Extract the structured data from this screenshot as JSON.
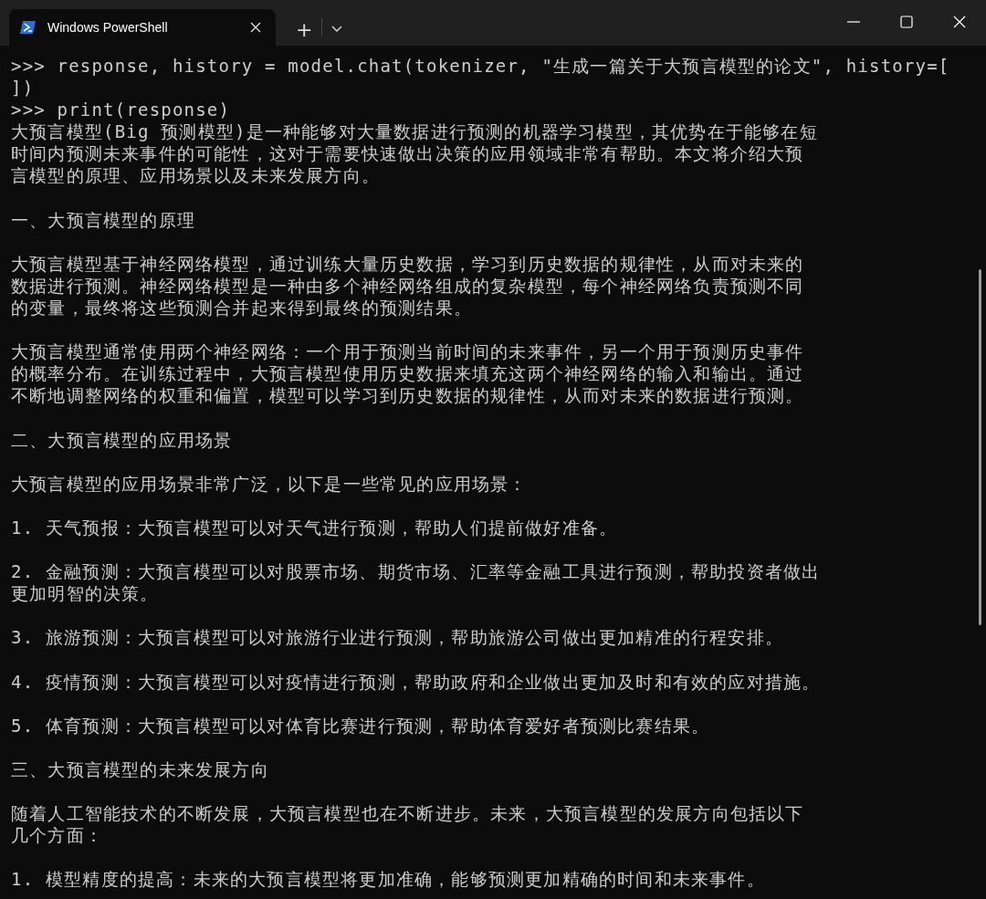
{
  "window": {
    "tab_title": "Windows PowerShell",
    "new_tab": "+"
  },
  "console": {
    "blocks": [
      {
        "rows": [
          ">>> response, history = model.chat(tokenizer, \"生成一篇关于大预言模型的论文\", history=[",
          "])",
          ">>> print(response)",
          "大预言模型(Big 预测模型)是一种能够对大量数据进行预测的机器学习模型，其优势在于能够在短",
          "时间内预测未来事件的可能性，这对于需要快速做出决策的应用领域非常有帮助。本文将介绍大预",
          "言模型的原理、应用场景以及未来发展方向。"
        ]
      },
      {
        "rows": [
          "一、大预言模型的原理"
        ]
      },
      {
        "rows": [
          "大预言模型基于神经网络模型，通过训练大量历史数据，学习到历史数据的规律性，从而对未来的",
          "数据进行预测。神经网络模型是一种由多个神经网络组成的复杂模型，每个神经网络负责预测不同",
          "的变量，最终将这些预测合并起来得到最终的预测结果。"
        ]
      },
      {
        "rows": [
          "大预言模型通常使用两个神经网络：一个用于预测当前时间的未来事件，另一个用于预测历史事件",
          "的概率分布。在训练过程中，大预言模型使用历史数据来填充这两个神经网络的输入和输出。通过",
          "不断地调整网络的权重和偏置，模型可以学习到历史数据的规律性，从而对未来的数据进行预测。"
        ]
      },
      {
        "rows": [
          "二、大预言模型的应用场景"
        ]
      },
      {
        "rows": [
          "大预言模型的应用场景非常广泛，以下是一些常见的应用场景："
        ]
      },
      {
        "rows": [
          "1. 天气预报：大预言模型可以对天气进行预测，帮助人们提前做好准备。"
        ]
      },
      {
        "rows": [
          "2. 金融预测：大预言模型可以对股票市场、期货市场、汇率等金融工具进行预测，帮助投资者做出",
          "更加明智的决策。"
        ]
      },
      {
        "rows": [
          "3. 旅游预测：大预言模型可以对旅游行业进行预测，帮助旅游公司做出更加精准的行程安排。"
        ]
      },
      {
        "rows": [
          "4. 疫情预测：大预言模型可以对疫情进行预测，帮助政府和企业做出更加及时和有效的应对措施。"
        ]
      },
      {
        "rows": [
          "5. 体育预测：大预言模型可以对体育比赛进行预测，帮助体育爱好者预测比赛结果。"
        ]
      },
      {
        "rows": [
          "三、大预言模型的未来发展方向"
        ]
      },
      {
        "rows": [
          "随着人工智能技术的不断发展，大预言模型也在不断进步。未来，大预言模型的发展方向包括以下",
          "几个方面："
        ]
      },
      {
        "rows": [
          "1. 模型精度的提高：未来的大预言模型将更加准确，能够预测更加精确的时间和未来事件。"
        ]
      }
    ]
  }
}
